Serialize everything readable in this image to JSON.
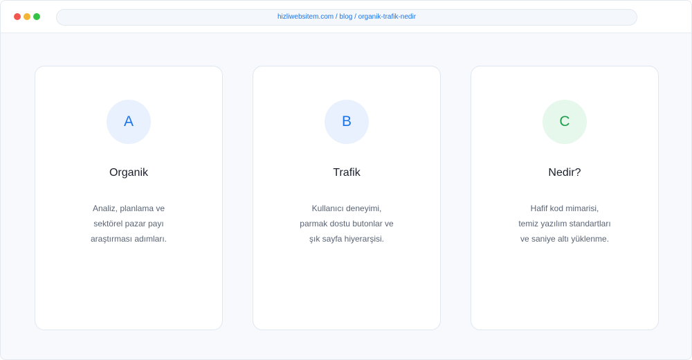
{
  "browser": {
    "url": "hizliwebsitem.com / blog / organik-trafik-nedir",
    "url_color": "#1a73e8",
    "dot_colors": {
      "red": "#f0584f",
      "yellow": "#f3b535",
      "green": "#36c246"
    }
  },
  "cards": [
    {
      "letter": "A",
      "title": "Organik",
      "lines": [
        "Analiz, planlama ve",
        "sektörel pazar payı",
        "araştırması adımları."
      ],
      "badge_bg": "#e8f1fd",
      "badge_color": "#1a73e8"
    },
    {
      "letter": "B",
      "title": "Trafik",
      "lines": [
        "Kullanıcı deneyimi,",
        "parmak dostu butonlar ve",
        "şık sayfa hiyerarşisi."
      ],
      "badge_bg": "#e8f1fd",
      "badge_color": "#1a73e8"
    },
    {
      "letter": "C",
      "title": "Nedir?",
      "lines": [
        "Hafif kod mimarisi,",
        "temiz yazılım standartları",
        "ve saniye altı yüklenme."
      ],
      "badge_bg": "#e6f7ec",
      "badge_color": "#1e9e4a"
    }
  ]
}
